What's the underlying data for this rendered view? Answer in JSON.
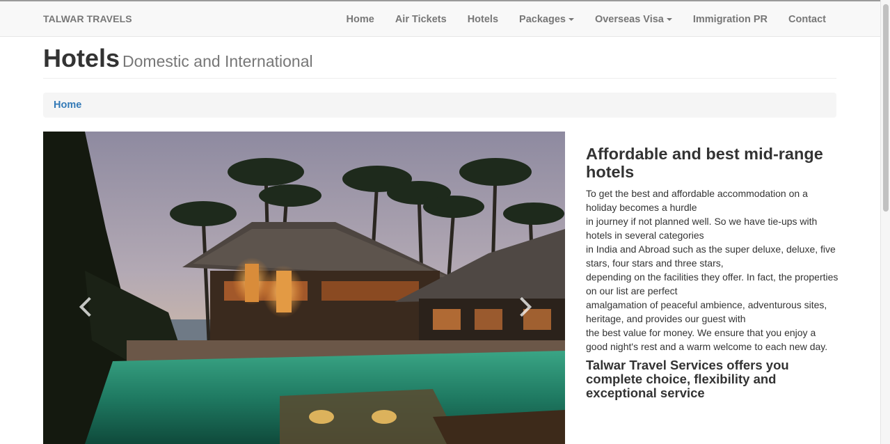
{
  "navbar": {
    "brand": "TALWAR TRAVELS",
    "items": [
      {
        "label": "Home"
      },
      {
        "label": "Air Tickets"
      },
      {
        "label": "Hotels"
      },
      {
        "label": "Packages"
      },
      {
        "label": "Overseas Visa"
      },
      {
        "label": "Immigration PR"
      },
      {
        "label": "Contact"
      }
    ]
  },
  "header": {
    "title": "Hotels",
    "subtitle": "Domestic and International"
  },
  "breadcrumb": {
    "home": "Home"
  },
  "carousel": {
    "prev_icon": "chevron-left-icon",
    "next_icon": "chevron-right-icon"
  },
  "content": {
    "heading": "Affordable and best mid-range hotels",
    "lines": [
      "To get the best and affordable accommodation on a holiday becomes a hurdle",
      "in journey if not planned well. So we have tie-ups with hotels in several categories",
      "in India and Abroad such as the super deluxe, deluxe, five stars, four stars and three stars,",
      "depending on the facilities they offer. In fact, the properties on our list are perfect",
      "amalgamation of peaceful ambience, adventurous sites, heritage, and provides our guest with",
      "the best value for money. We ensure that you enjoy a good night's rest and a warm welcome to each new day."
    ],
    "tagline": "Talwar Travel Services offers you complete choice, flexibility and exceptional service"
  },
  "colors": {
    "link": "#337ab7",
    "navbar_bg": "#f8f8f8",
    "nav_text": "#777777"
  }
}
